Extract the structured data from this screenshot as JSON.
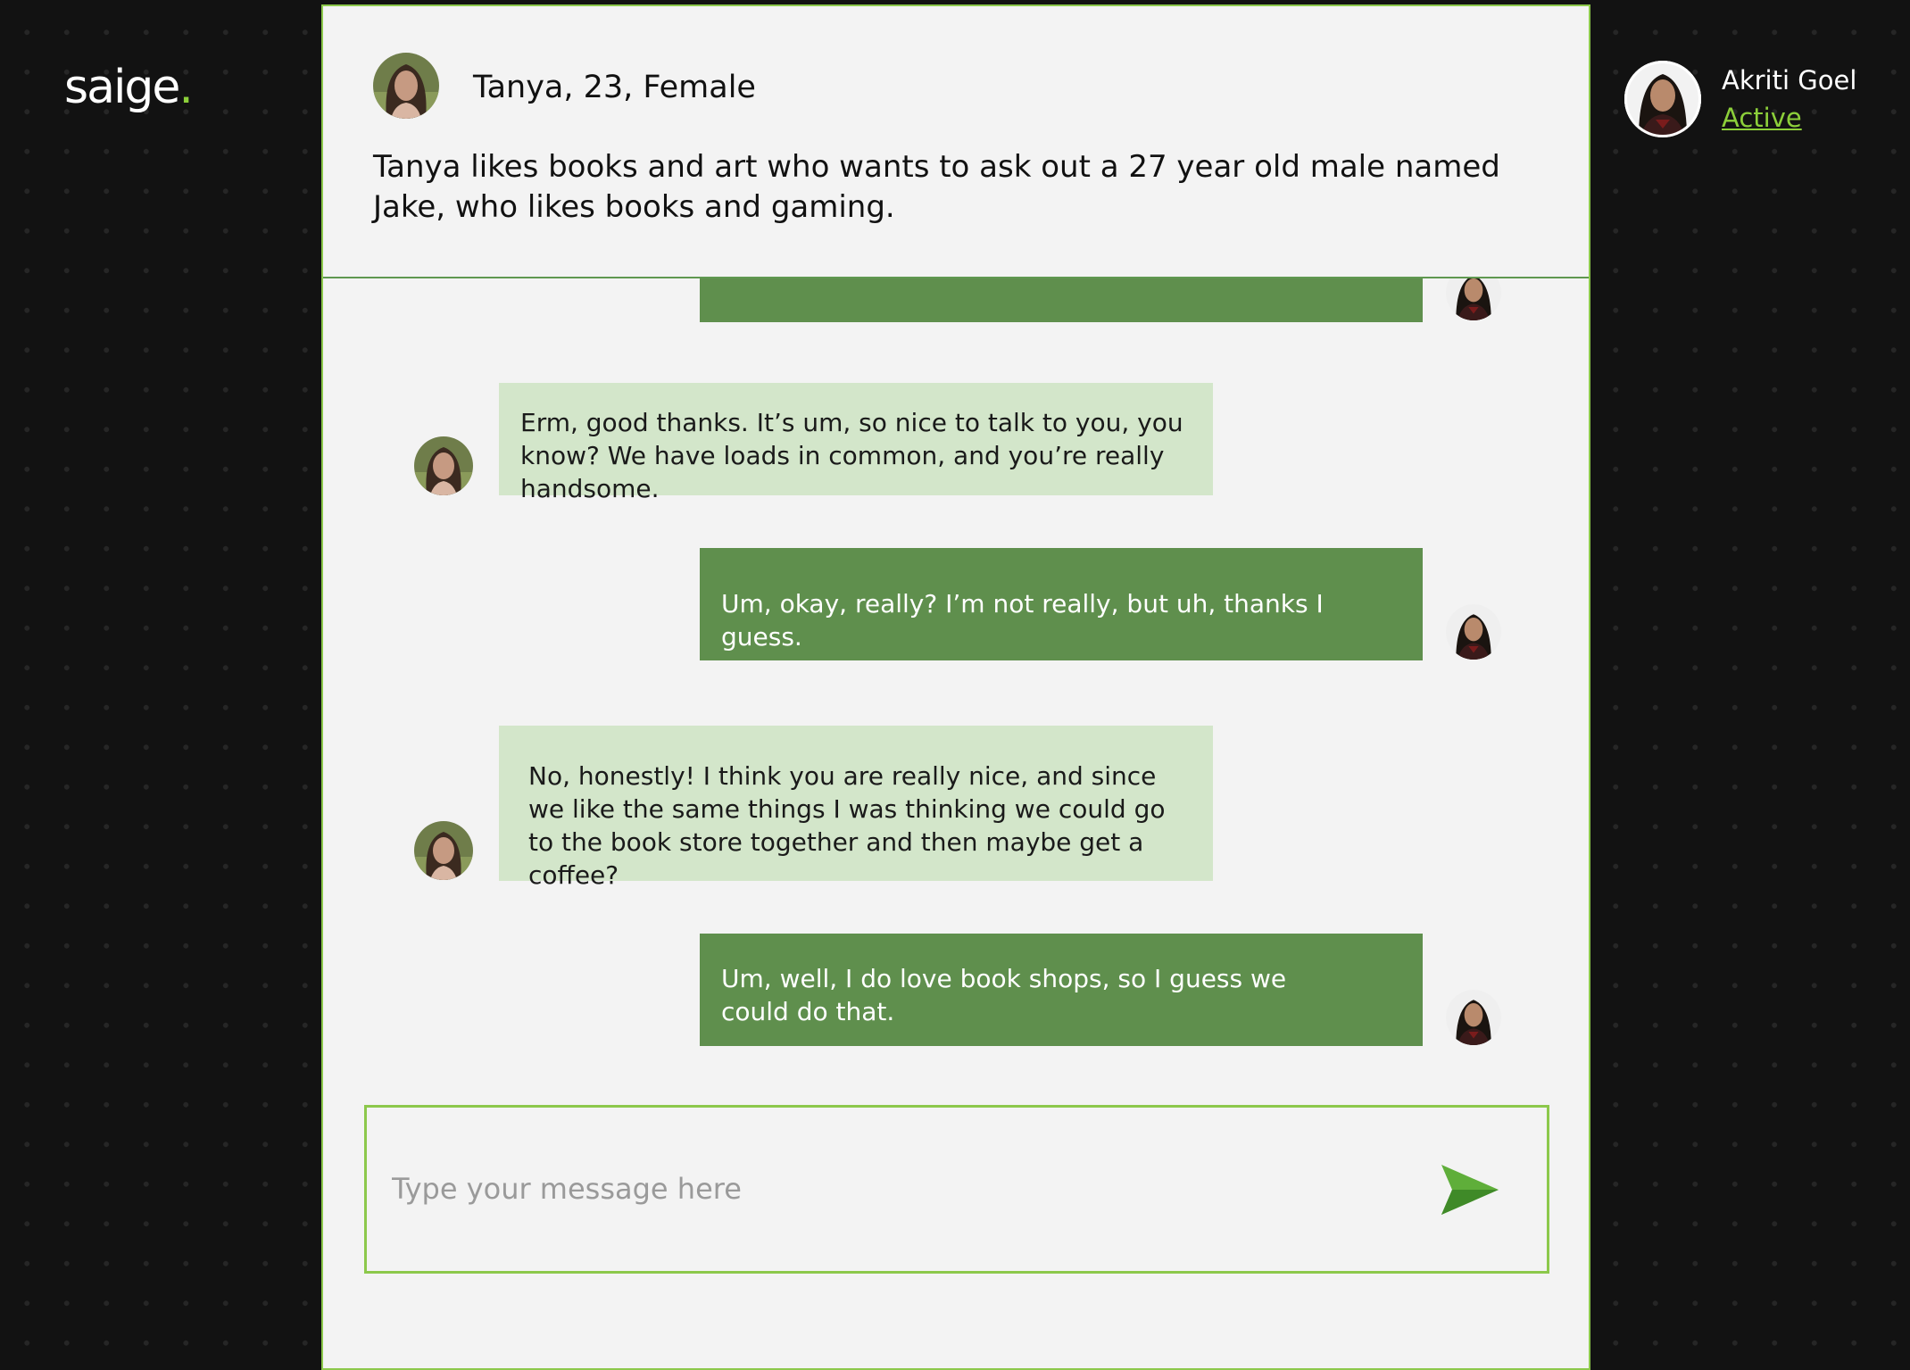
{
  "app": {
    "logo_text": "saige",
    "logo_dot": "."
  },
  "persona": {
    "name_line": "Tanya, 23, Female",
    "description": "Tanya likes books and art who wants to ask out a 27 year old male named Jake, who likes books and gaming.",
    "avatar_icon": "persona-avatar"
  },
  "messages": [
    {
      "sender": "user",
      "text": ""
    },
    {
      "sender": "persona",
      "text": "Erm, good thanks. It’s um, so nice to talk to you, you know? We have loads in common, and you’re really handsome."
    },
    {
      "sender": "user",
      "text": "Um, okay, really? I’m not really, but uh, thanks I guess."
    },
    {
      "sender": "persona",
      "text": "No, honestly! I think you are really nice, and since we like the same things I was thinking we could go to the book store together and then maybe get a coffee?"
    },
    {
      "sender": "user",
      "text": "Um, well, I do love book shops, so I guess we could do that."
    }
  ],
  "composer": {
    "placeholder": "Type your message here",
    "send_icon": "send-icon"
  },
  "user": {
    "name": "Akriti Goel",
    "status": "Active"
  },
  "colors": {
    "accent": "#8ccf3a",
    "panel_border": "#8cc84b",
    "incoming_bubble": "#d3e6ca",
    "outgoing_bubble": "#5f8f4d",
    "panel_bg": "#f3f3f3",
    "page_bg": "#121212"
  }
}
